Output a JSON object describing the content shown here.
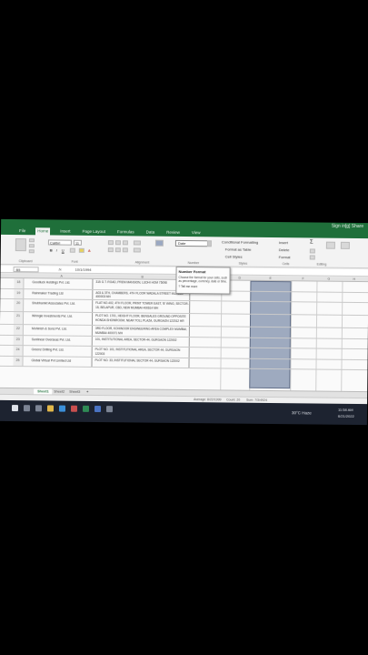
{
  "window": {
    "signin": "Sign in",
    "user": "[g] Share"
  },
  "tabs": [
    "File",
    "Home",
    "Insert",
    "Page Layout",
    "Formulas",
    "Data",
    "Review",
    "View"
  ],
  "ribbon": {
    "font_name": "Calibri",
    "font_size": "11",
    "number_format": "Date",
    "conditional_formatting": "Conditional Formatting",
    "format_as_table": "Format as Table",
    "cell_styles": "Cell Styles",
    "insert": "Insert",
    "delete": "Delete",
    "format": "Format",
    "groups": [
      "Clipboard",
      "Font",
      "Alignment",
      "Number",
      "Styles",
      "Cells",
      "Editing"
    ]
  },
  "tooltip": {
    "title": "Number Format",
    "body": "Choose the format for your cells, such as percentage, currency, date or time.",
    "more": "Tell me more"
  },
  "formula_bar": {
    "name_box": "B5",
    "fx": "fx",
    "value": "10/1/1994"
  },
  "column_headers": [
    "A",
    "B",
    "C",
    "D",
    "E",
    "F",
    "G",
    "H"
  ],
  "rows": [
    {
      "num": "18",
      "name": "Goodluck Holdings Pvt. Ltd.",
      "address": "315 G.T. ROAD, PREM MANSION, LUDHI HOM 75098"
    },
    {
      "num": "19",
      "name": "Rainmaker Trading Ltd",
      "address": "A03 & 3TH, CHAMBERS, 4TH FLOOR WADALA STREET MUMBAI 400003 MH"
    },
    {
      "num": "20",
      "name": "Shubhamkt Associates Pvt. Ltd.",
      "address": "FLAT NO.402, 4TH FLOOR, PRINT TOWER EAST, 'B' WING, SECTOR-15, BELAPUR, CBD, NEW MUMBAI 400614 MH"
    },
    {
      "num": "21",
      "name": "Whingle Investments Pvt. Ltd.",
      "address": "PLOT NO. 1701, HEIGHT FLOOR, BENGALES GROUND OPPOSITE HONDA SHOWROOM, NEAR TOLL PLAZA, GURGAON 122012 HR"
    },
    {
      "num": "22",
      "name": "Mohinish & Sons Pvt. Ltd.",
      "address": "3RD FLOOR, KOHINOOR ENGINEERING AREA COMPLEX MUMBAI, MUMBAI 400071 MH"
    },
    {
      "num": "23",
      "name": "Sunlinear Overseas Pvt. Ltd.",
      "address": "101, INSTITUTIONAL AREA, SECTOR-44, GURGAON 122002"
    },
    {
      "num": "24",
      "name": "Greenz Drilling Pvt. Ltd.",
      "address": "PLOT NO. 101, INSTITUTIONAL AREA, SECTOR 44, GURGAON 122003"
    },
    {
      "num": "25",
      "name": "Global Virtual Pvt Limited Ltd",
      "address": "PLOT NO. 33, INSTITUTIONAL SECTOR 44, GURGAON 122002"
    }
  ],
  "sheets": [
    "Sheet1",
    "Sheet2",
    "Sheet3"
  ],
  "status": {
    "average": "Average: 8/22/1999",
    "count": "Count: 20",
    "sum": "Sum: 7/3/4924"
  },
  "taskbar": {
    "weather": "30°C Haze",
    "time": "11:58 AM",
    "date": "6/21/2022"
  },
  "colors": {
    "excel_green": "#1f6f3a",
    "selection": "#8f9db5",
    "taskbar": "#1d2330"
  }
}
